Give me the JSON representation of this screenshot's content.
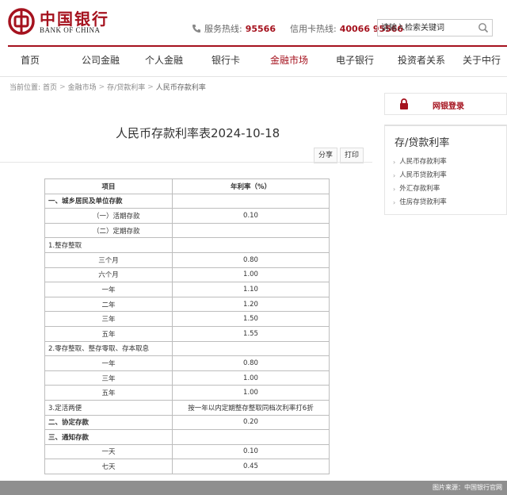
{
  "brand": {
    "name_cn": "中国银行",
    "name_en": "BANK OF CHINA",
    "color": "#a5121e"
  },
  "hotlines": {
    "service_label": "服务热线:",
    "service_number": "95566",
    "credit_label": "信用卡热线:",
    "credit_number": "40066 95566"
  },
  "search": {
    "value": "请输入检索关键词",
    "icon": "search-icon"
  },
  "nav": {
    "items": [
      "首页",
      "公司金融",
      "个人金融",
      "银行卡",
      "金融市场",
      "电子银行",
      "投资者关系",
      "关于中行"
    ],
    "active": "金融市场"
  },
  "breadcrumb": {
    "prefix": "当前位置:",
    "items": [
      "首页",
      "金融市场",
      "存/贷款利率",
      "人民币存款利率"
    ]
  },
  "main": {
    "title": "人民币存款利率表2024-10-18",
    "share_label": "分享",
    "print_label": "打印"
  },
  "table": {
    "headers": [
      "项目",
      "年利率（%）"
    ],
    "rows": [
      {
        "item": "一、城乡居民及单位存款",
        "rate": "",
        "style": "l1"
      },
      {
        "item": "（一）活期存款",
        "rate": "0.10",
        "style": "l2"
      },
      {
        "item": "（二）定期存款",
        "rate": "",
        "style": "l2"
      },
      {
        "item": "1.整存整取",
        "rate": "",
        "style": "l1"
      },
      {
        "item": "三个月",
        "rate": "0.80",
        "style": "c"
      },
      {
        "item": "六个月",
        "rate": "1.00",
        "style": "c"
      },
      {
        "item": "一年",
        "rate": "1.10",
        "style": "c"
      },
      {
        "item": "二年",
        "rate": "1.20",
        "style": "c"
      },
      {
        "item": "三年",
        "rate": "1.50",
        "style": "c"
      },
      {
        "item": "五年",
        "rate": "1.55",
        "style": "c"
      },
      {
        "item": "2.零存整取、整存零取、存本取息",
        "rate": "",
        "style": "l1"
      },
      {
        "item": "一年",
        "rate": "0.80",
        "style": "c"
      },
      {
        "item": "三年",
        "rate": "1.00",
        "style": "c"
      },
      {
        "item": "五年",
        "rate": "1.00",
        "style": "c"
      },
      {
        "item": "3.定活两便",
        "rate": "按一年以内定期整存整取同档次利率打6折",
        "style": "l1"
      },
      {
        "item": "二、协定存款",
        "rate": "0.20",
        "style": "l1"
      },
      {
        "item": "三、通知存款",
        "rate": "",
        "style": "l1"
      },
      {
        "item": "一天",
        "rate": "0.10",
        "style": "c"
      },
      {
        "item": "七天",
        "rate": "0.45",
        "style": "c"
      }
    ]
  },
  "sidebar": {
    "login_label": "网银登录",
    "panel_title": "存/贷款利率",
    "links": [
      "人民币存款利率",
      "人民币贷款利率",
      "外汇存款利率",
      "住房存贷款利率"
    ]
  },
  "footer": {
    "credit": "图片来源：中国银行官网"
  }
}
